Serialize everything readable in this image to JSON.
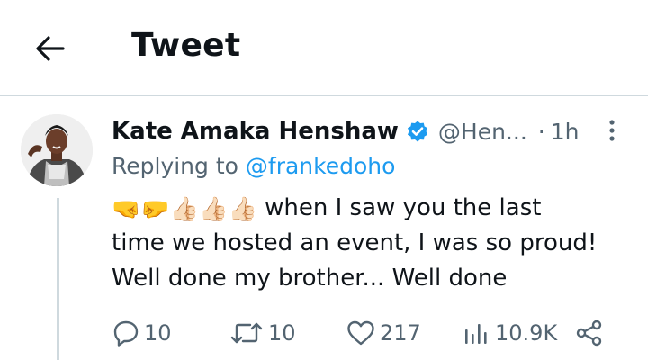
{
  "header": {
    "title": "Tweet",
    "back_icon": "arrow-left-icon"
  },
  "tweet": {
    "display_name": "Kate Amaka Henshaw",
    "verified_icon": "verified-badge-icon",
    "handle": "@Hen...",
    "separator": "·",
    "time": "1h",
    "more_icon": "more-vertical-icon",
    "replying_prefix": "Replying to",
    "replying_to": "@frankedoho",
    "emojis": [
      "🤜",
      "🤛",
      "👍🏻",
      "👍🏻",
      "👍🏻"
    ],
    "text_line1": "when I saw you the last",
    "text_line2": "time we hosted an event, I was so proud!",
    "text_line3": "Well done my brother... Well done"
  },
  "actions": {
    "replies": "10",
    "retweets": "10",
    "likes": "217",
    "views": "10.9K"
  },
  "colors": {
    "text": "#0f1419",
    "muted": "#536471",
    "link": "#1d9bf0",
    "divider": "#cfd9de"
  }
}
